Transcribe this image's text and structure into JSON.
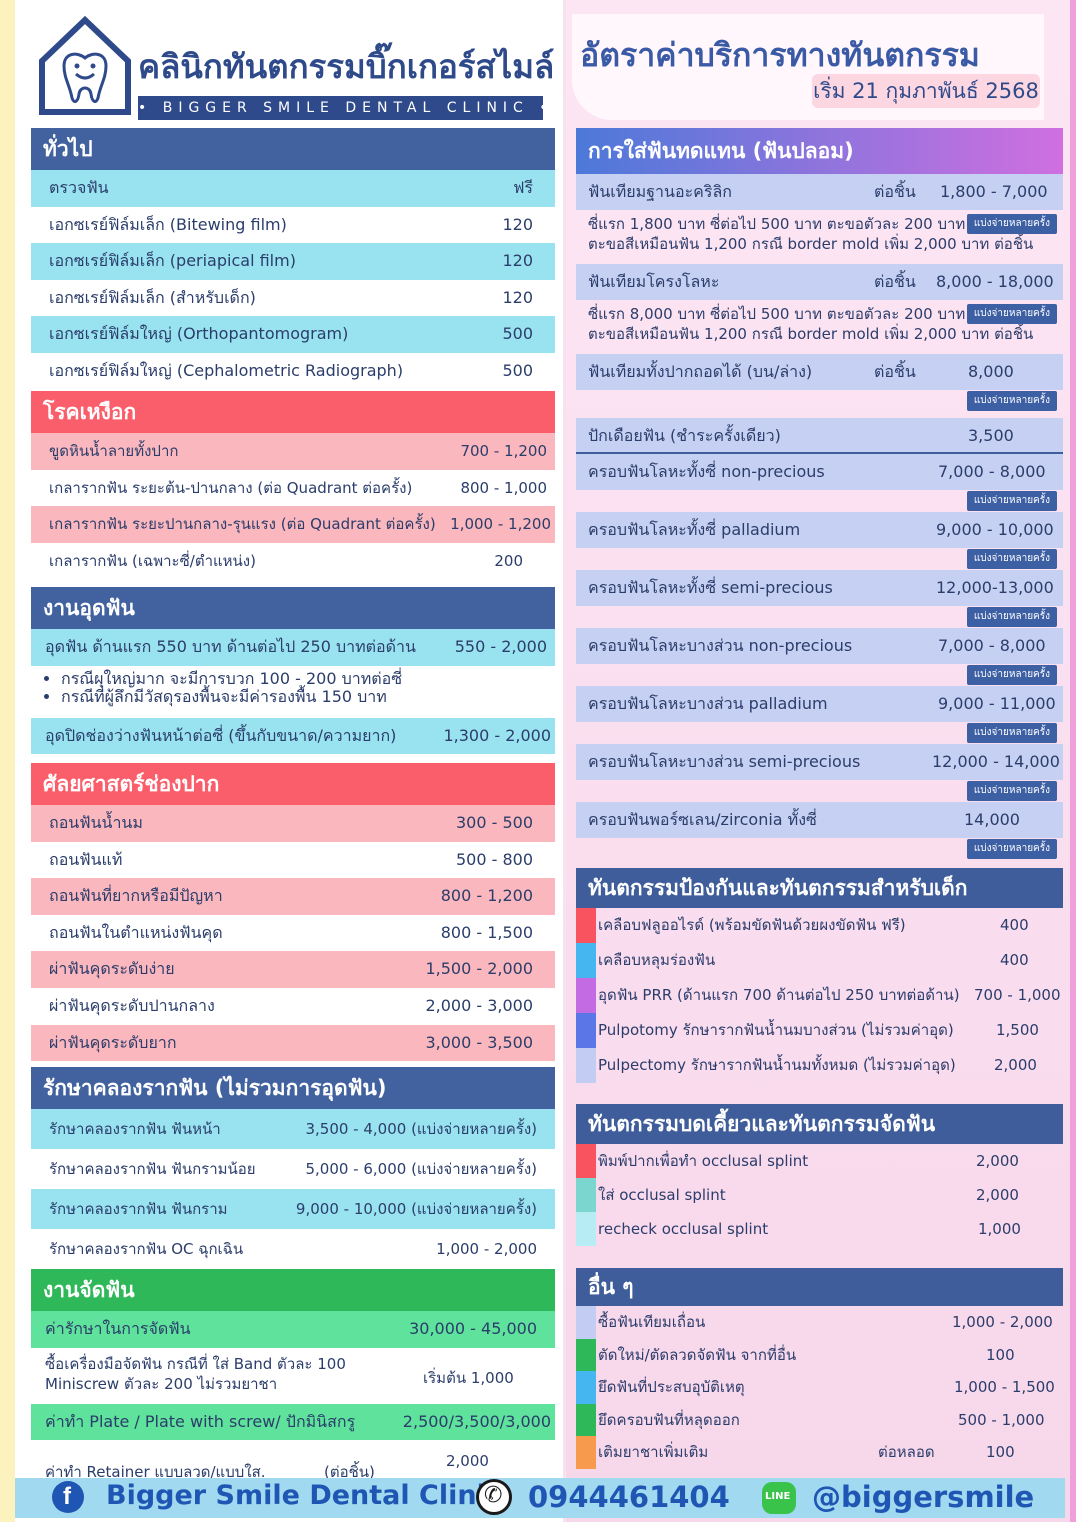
{
  "logo": {
    "name_th": "คลินิกทันตกรรมบิ๊กเกอร์สไมล์",
    "name_en": "• BIGGER SMILE DENTAL CLINIC •"
  },
  "header": {
    "title": "อัตราค่าบริการทางทันตกรรม",
    "date": "เริ่ม 21 กุมภาพันธ์ 2568"
  },
  "general": {
    "title": "ทั่วไป",
    "rows": [
      {
        "l": "ตรวจฟัน",
        "r": "ฟรี"
      },
      {
        "l": "เอกซเรย์ฟิล์มเล็ก (Bitewing film)",
        "r": "120"
      },
      {
        "l": "เอกซเรย์ฟิล์มเล็ก (periapical film)",
        "r": "120"
      },
      {
        "l": "เอกซเรย์ฟิล์มเล็ก (สำหรับเด็ก)",
        "r": "120"
      },
      {
        "l": "เอกซเรย์ฟิล์มใหญ่ (Orthopantomogram)",
        "r": "500"
      },
      {
        "l": "เอกซเรย์ฟิล์มใหญ่ (Cephalometric Radiograph)",
        "r": "500"
      }
    ]
  },
  "gum": {
    "title": "โรคเหงือก",
    "rows": [
      {
        "l": "ขูดหินน้ำลายทั้งปาก",
        "r": "700 - 1,200"
      },
      {
        "l": "เกลารากฟัน ระยะต้น-ปานกลาง (ต่อ Quadrant ต่อครั้ง)",
        "r": "800 - 1,000"
      },
      {
        "l": "เกลารากฟัน ระยะปานกลาง-รุนแรง (ต่อ Quadrant ต่อครั้ง)",
        "r": "1,000 - 1,200"
      },
      {
        "l": "เกลารากฟัน (เฉพาะซี่/ตำแหน่ง)",
        "r": "200"
      }
    ]
  },
  "filling": {
    "title": "งานอุดฟัน",
    "row1": {
      "l": "อุดฟัน ด้านแรก 550 บาท ด้านต่อไป 250 บาทต่อด้าน",
      "r": "550 - 2,000"
    },
    "bullets": [
      "กรณีผุใหญ่มาก จะมีการบวก 100 - 200 บาทต่อซี่",
      "กรณีที่ผู้ลึกมีวัสดุรองพื้นจะมีค่ารองพื้น 150 บาท"
    ],
    "row2": {
      "l": "อุดปิดช่องว่างฟันหน้าต่อซี่ (ขึ้นกับขนาด/ความยาก)",
      "r": "1,300 - 2,000"
    }
  },
  "surgery": {
    "title": "ศัลยศาสตร์ช่องปาก",
    "rows": [
      {
        "l": "ถอนฟันน้ำนม",
        "r": "300 - 500"
      },
      {
        "l": "ถอนฟันแท้",
        "r": "500 - 800"
      },
      {
        "l": "ถอนฟันที่ยากหรือมีปัญหา",
        "r": "800 - 1,200"
      },
      {
        "l": "ถอนฟันในตำแหน่งฟันคุด",
        "r": "800 - 1,500"
      },
      {
        "l": "ผ่าฟันคุดระดับง่าย",
        "r": "1,500 - 2,000"
      },
      {
        "l": "ผ่าฟันคุดระดับปานกลาง",
        "r": "2,000 - 3,000"
      },
      {
        "l": "ผ่าฟันคุดระดับยาก",
        "r": "3,000 - 3,500"
      }
    ]
  },
  "root": {
    "title": "รักษาคลองรากฟัน (ไม่รวมการอุดฟัน)",
    "rows": [
      {
        "l": "รักษาคลองรากฟัน ฟันหน้า",
        "r": "3,500 - 4,000 (แบ่งจ่ายหลายครั้ง)"
      },
      {
        "l": "รักษาคลองรากฟัน ฟันกรามน้อย",
        "r": "5,000 - 6,000 (แบ่งจ่ายหลายครั้ง)"
      },
      {
        "l": "รักษาคลองรากฟัน ฟันกราม",
        "r": "9,000 - 10,000 (แบ่งจ่ายหลายครั้ง)"
      },
      {
        "l": "รักษาคลองรากฟัน OC ฉุกเฉิน",
        "r": "1,000 - 2,000"
      }
    ]
  },
  "ortho": {
    "title": "งานจัดฟัน",
    "r1": {
      "l": "ค่ารักษาในการจัดฟัน",
      "r": "30,000 - 45,000"
    },
    "r2": {
      "l1": "ซื้อเครื่องมือจัดฟัน กรณีที่ ใส่ Band ตัวละ 100",
      "l2": "Miniscrew ตัวละ 200 ไม่รวมยาชา",
      "r": "เริ่มต้น 1,000"
    },
    "r3": {
      "l": "ค่าทำ Plate / Plate with screw/ ปักมินิสกรู",
      "r": "2,500/3,500/3,000"
    },
    "r4": {
      "l": "ค่าทำ Retainer แบบลวด/แบบใส.",
      "m": "(ต่อชิ้น)",
      "r": "2,000"
    }
  },
  "prosth": {
    "title": "การใส่ฟันทดแทน (ฟันปลอม)",
    "split": "แบ่งจ่ายหลายครั้ง",
    "acrylic": {
      "l": "ฟันเทียมฐานอะคริลิก",
      "u": "ต่อชิ้น",
      "r": "1,800 - 7,000",
      "n1": "ซี่แรก 1,800 บาท ซี่ต่อไป 500 บาท ตะขอตัวละ 200 บาท",
      "n2": "ตะขอสีเหมือนฟัน 1,200 กรณี border mold เพิ่ม 2,000 บาท ต่อชิ้น"
    },
    "metal": {
      "l": "ฟันเทียมโครงโลหะ",
      "u": "ต่อชิ้น",
      "r": "8,000 - 18,000",
      "n1": "ซี่แรก 8,000 บาท ซี่ต่อไป 500 บาท ตะขอตัวละ 200 บาท",
      "n2": "ตะขอสีเหมือนฟัน 1,200 กรณี border mold เพิ่ม 2,000 บาท ต่อชิ้น"
    },
    "full": {
      "l": "ฟันเทียมทั้งปากถอดได้ (บน/ล่าง)",
      "u": "ต่อชิ้น",
      "r": "8,000"
    },
    "post": {
      "l": "ปักเดือยฟัน (ชำระครั้งเดียว)",
      "r": "3,500"
    },
    "crowns": [
      {
        "l": "ครอบฟันโลหะทั้งซี่ non-precious",
        "r": "7,000 - 8,000"
      },
      {
        "l": "ครอบฟันโลหะทั้งซี่ palladium",
        "r": "9,000 - 10,000"
      },
      {
        "l": "ครอบฟันโลหะทั้งซี่ semi-precious",
        "r": "12,000-13,000"
      },
      {
        "l": "ครอบฟันโลหะบางส่วน non-precious",
        "r": "7,000 - 8,000"
      },
      {
        "l": "ครอบฟันโลหะบางส่วน palladium",
        "r": "9,000 - 11,000"
      },
      {
        "l": "ครอบฟันโลหะบางส่วน semi-precious",
        "r": "12,000 - 14,000"
      },
      {
        "l": "ครอบฟันพอร์ซเลน/zirconia ทั้งซี่",
        "r": "14,000"
      }
    ]
  },
  "kids": {
    "title": "ทันตกรรมป้องกันและทันตกรรมสำหรับเด็ก",
    "rows": [
      {
        "l": "เคลือบฟลูออไรด์ (พร้อมขัดฟันด้วยผงขัดฟัน ฟรี)",
        "r": "400",
        "c": "#f8535e"
      },
      {
        "l": "เคลือบหลุมร่องฟัน",
        "r": "400",
        "c": "#45b6f0"
      },
      {
        "l": "อุดฟัน PRR (ด้านแรก 700 ด้านต่อไป 250 บาทต่อด้าน)",
        "r": "700 - 1,000",
        "c": "#c26be2"
      },
      {
        "l": "Pulpotomy รักษารากฟันน้ำนมบางส่วน (ไม่รวมค่าอุด)",
        "r": "1,500",
        "c": "#5b76e6"
      },
      {
        "l": "Pulpectomy รักษารากฟันน้ำนมทั้งหมด (ไม่รวมค่าอุด)",
        "r": "2,000",
        "c": "#c3cdf3"
      }
    ]
  },
  "occl": {
    "title": "ทันตกรรมบดเคี้ยวและทันตกรรมจัดฟัน",
    "rows": [
      {
        "l": "พิมพ์ปากเพื่อทำ occlusal splint",
        "r": "2,000",
        "c": "#f8535e"
      },
      {
        "l": "ใส่ occlusal splint",
        "r": "2,000",
        "c": "#7bd6d0"
      },
      {
        "l": "recheck occlusal  splint",
        "r": "1,000",
        "c": "#b7ecf4"
      }
    ]
  },
  "other": {
    "title": "อื่น ๆ",
    "rows": [
      {
        "l": "ซื้อฟันเทียมเถื่อน",
        "u": "",
        "r": "1,000 - 2,000",
        "c": "#c3cdf3"
      },
      {
        "l": "ตัดใหม่/ตัดลวดจัดฟัน จากที่อื่น",
        "u": "",
        "r": "100",
        "c": "#2fb85a"
      },
      {
        "l": "ยึดฟันที่ประสบอุบัติเหตุ",
        "u": "",
        "r": "1,000 - 1,500",
        "c": "#45b6f0"
      },
      {
        "l": "ยึดครอบฟันที่หลุดออก",
        "u": "",
        "r": "500 - 1,000",
        "c": "#2fb85a"
      },
      {
        "l": "เติมยาชาเพิ่มเติม",
        "u": "ต่อหลอด",
        "r": "100",
        "c": "#f89a4e"
      }
    ]
  },
  "footer": {
    "facebook": "Bigger Smile Dental Clinic",
    "phone": "0944461404",
    "line": "@biggersmile",
    "line_badge": "LINE"
  }
}
